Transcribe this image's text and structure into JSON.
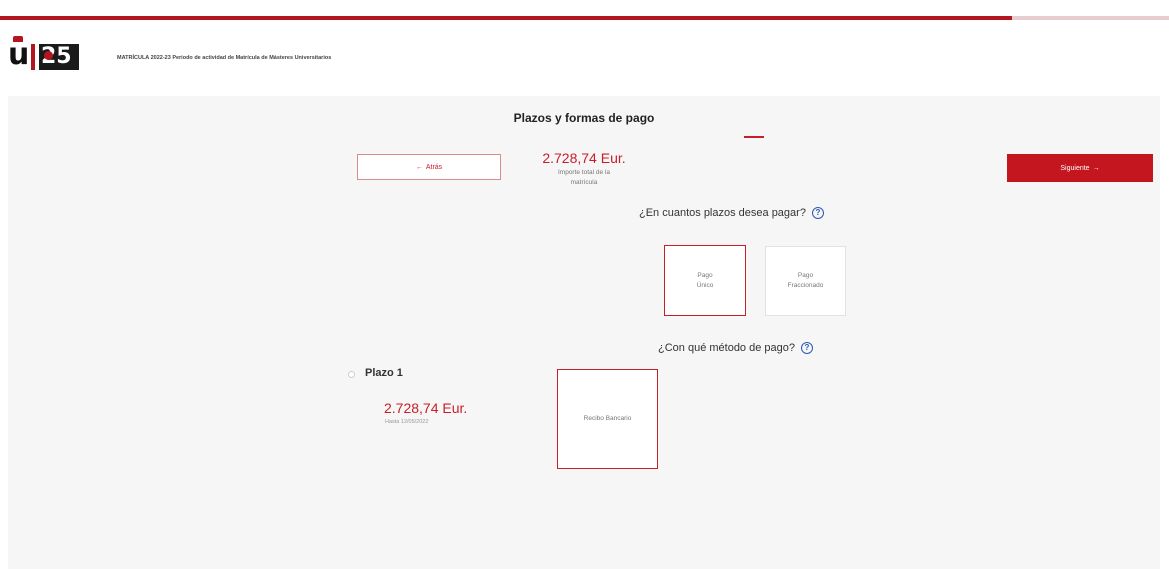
{
  "header": {
    "title": "MATRÍCULA 2022-23 Periodo de actividad de Matrícula de Másteres Universitarios",
    "progress_percent": 86.6
  },
  "colors": {
    "accent": "#c81e29",
    "button": "#c4161e",
    "help_icon": "#2c58b5"
  },
  "main": {
    "section_title": "Plazos y formas de pago",
    "total_amount": "2.728,74 Eur.",
    "total_caption_line1": "Importe total de la",
    "total_caption_line2": "matrícula",
    "back_button": {
      "icon": "arrow-left-icon",
      "label": "Atrás"
    },
    "next_button": {
      "label": "Siguiente",
      "icon": "arrow-right-icon"
    },
    "installments_question": "¿En cuantos plazos desea pagar?",
    "installment_options": [
      {
        "line1": "Pago",
        "line2": "Único",
        "selected": true
      },
      {
        "line1": "Pago",
        "line2": "Fraccionado",
        "selected": false
      }
    ],
    "method_question": "¿Con qué método de pago?",
    "plazo": {
      "label": "Plazo 1",
      "amount": "2.728,74 Eur.",
      "due": "Hasta 12/05/2022"
    },
    "payment_methods": [
      {
        "label": "Recibo Bancario",
        "selected": true
      }
    ]
  }
}
